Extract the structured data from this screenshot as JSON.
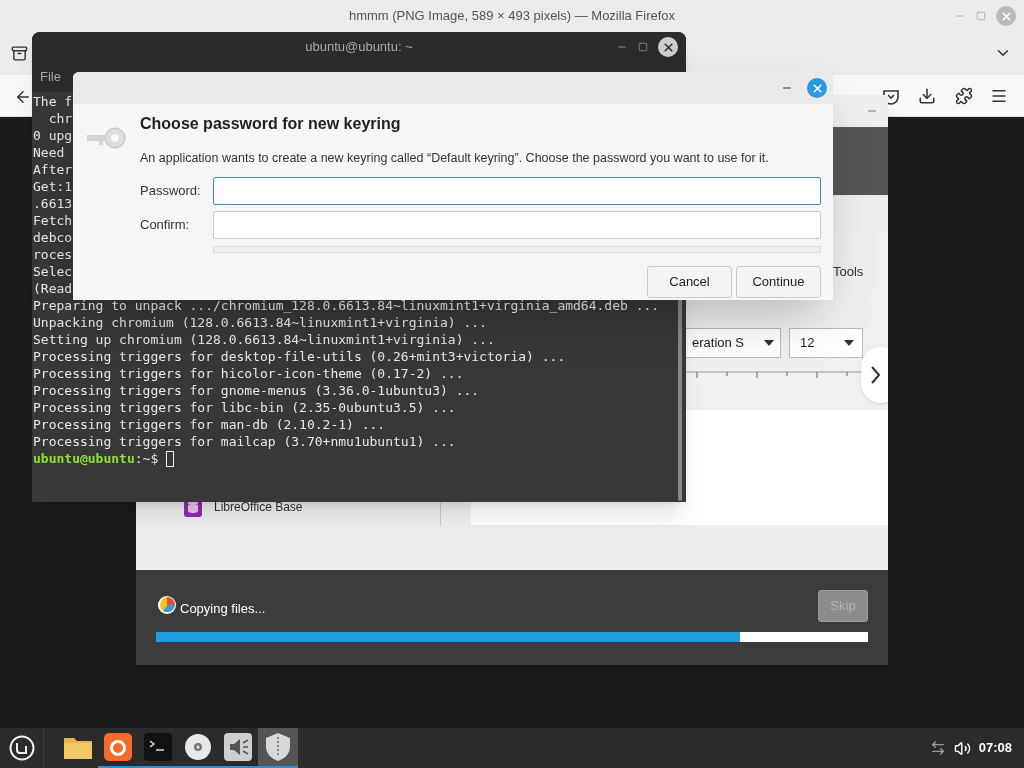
{
  "browser": {
    "title": "hmmm (PNG Image, 589 × 493 pixels) — Mozilla Firefox"
  },
  "terminal": {
    "title": "ubuntu@ubuntu: ~",
    "menu": [
      "File"
    ],
    "lines": [
      "The f",
      "  chr",
      "0 upg",
      "Need",
      "After",
      "Get:1",
      ".6613",
      "Fetch",
      "debco",
      "roces",
      "Selec",
      "(Read",
      "Preparing to unpack .../chromium_128.0.6613.84~linuxmint1+virginia_amd64.deb ...",
      "Unpacking chromium (128.0.6613.84~linuxmint1+virginia) ...",
      "Setting up chromium (128.0.6613.84~linuxmint1+virginia) ...",
      "Processing triggers for desktop-file-utils (0.26+mint3+victoria) ...",
      "Processing triggers for hicolor-icon-theme (0.17-2) ...",
      "Processing triggers for gnome-menus (3.36.0-1ubuntu3) ...",
      "Processing triggers for libc-bin (2.35-0ubuntu3.5) ...",
      "Processing triggers for man-db (2.10.2-1) ...",
      "Processing triggers for mailcap (3.70+nmu1ubuntu1) ..."
    ],
    "prompt": {
      "user": "ubuntu@ubuntu",
      "path": ":~$"
    }
  },
  "installer": {
    "writer": {
      "menu": [
        "Tools"
      ],
      "font_name": "eration S",
      "font_size": "12"
    },
    "apps": [
      {
        "label": "LibreOffice Base"
      }
    ],
    "status": "Copying files...",
    "skip": {
      "label": "Skip",
      "disabled": true
    },
    "progress": {
      "level": 0.82
    }
  },
  "dialog": {
    "title": "Choose password for new keyring",
    "description": "An application wants to create a new keyring called “Default keyring”. Choose the password you want to use for it.",
    "fields": [
      {
        "label": "Password:",
        "focused": true
      },
      {
        "label": "Confirm:",
        "focused": false
      }
    ],
    "strength": {
      "level": 0
    },
    "buttons": [
      "Cancel",
      "Continue"
    ]
  },
  "taskbar": {
    "apps": [
      {
        "kind": "folder",
        "running": false,
        "selected": false
      },
      {
        "kind": "firefox",
        "running": true,
        "selected": false
      },
      {
        "kind": "terminal",
        "running": true,
        "selected": false
      },
      {
        "kind": "disc",
        "running": true,
        "selected": false
      },
      {
        "kind": "sound",
        "running": true,
        "selected": false
      },
      {
        "kind": "shield",
        "running": true,
        "selected": true
      }
    ],
    "clock": "07:08"
  }
}
